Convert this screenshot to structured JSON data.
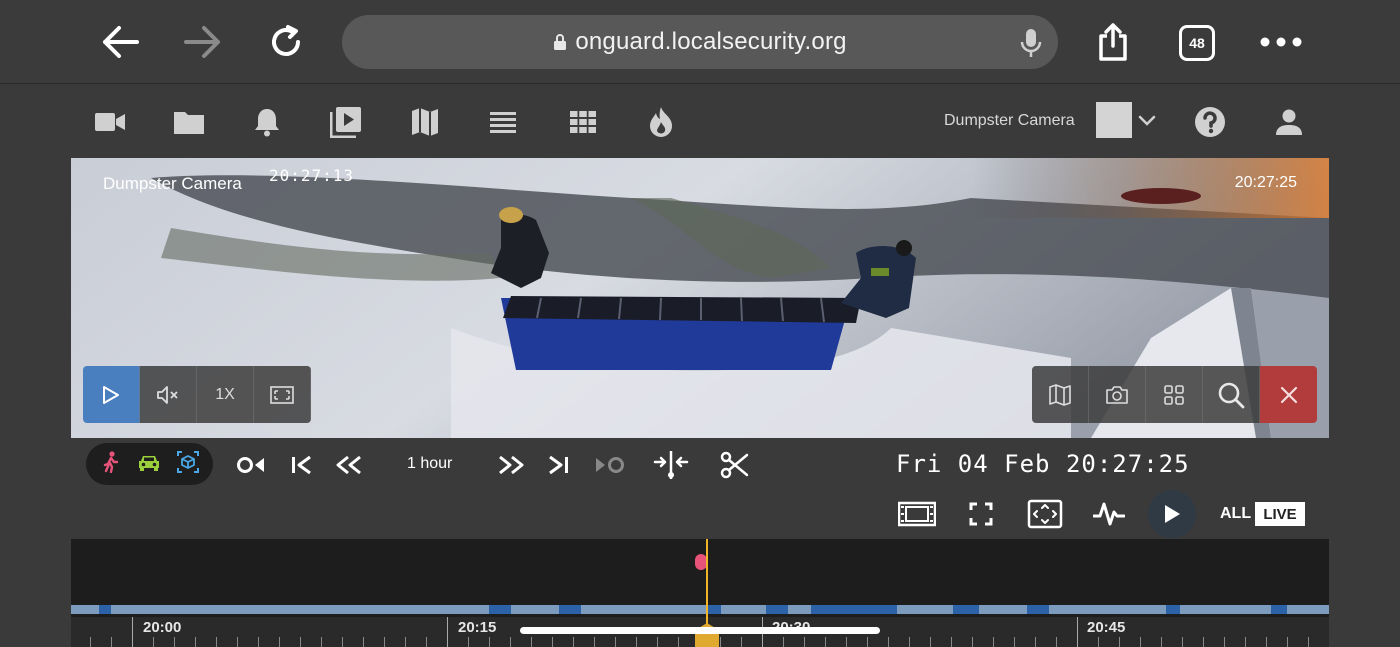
{
  "browser": {
    "url": "onguard.localsecurity.org",
    "tab_count": "48"
  },
  "app": {
    "camera_selector": "Dumpster Camera"
  },
  "video": {
    "overlay_name": "Dumpster Camera",
    "camera_stamp": "20:27:13",
    "time": "20:27:25",
    "speed": "1X"
  },
  "controls": {
    "span": "1 hour",
    "datetime": "Fri 04 Feb 20:27:25",
    "all_label": "ALL",
    "live_label": "LIVE"
  },
  "timeline": {
    "labels": [
      "20:00",
      "20:15",
      "20:30",
      "20:45"
    ]
  },
  "colors": {
    "accent": "#4a7fbf",
    "close": "#b23b3b",
    "cursor": "#f0b429",
    "event": "#e8537a"
  }
}
